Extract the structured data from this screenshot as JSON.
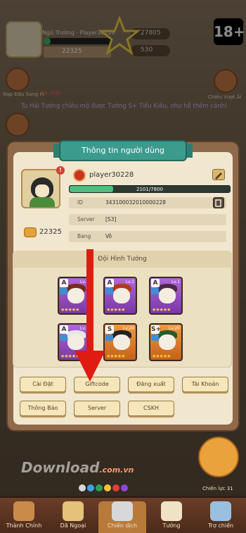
{
  "hud": {
    "name": "Ngũ Trường · Player30228",
    "power": "22325",
    "res1": "27805",
    "res2": "530",
    "age_badge": "18+",
    "exp_fraction": 0.1
  },
  "side": {
    "left_label": "Nạp Đầu Sang Hi",
    "right_label": "Chiêu Vượt Ải",
    "left_tag": "Đã nhận"
  },
  "ticker": "Tu Hải Tướng chiêu mộ được Tướng S+ Tiểu Kiều, như hổ thêm cánh!",
  "modal": {
    "title": "Thông tin người dùng",
    "player_name": "player30228",
    "exp_text": "2101/7800",
    "exp_fraction": 0.27,
    "rows": [
      {
        "label": "ID",
        "value": "343100032010000228"
      },
      {
        "label": "Server",
        "value": "[S3]"
      },
      {
        "label": "Bang",
        "value": "Vô"
      }
    ],
    "power": "22325",
    "team_title": "Đội Hình Tướng"
  },
  "heroes": [
    {
      "rank": "A",
      "level": "Lv.1",
      "color": "purple",
      "hair": "#7a2a1a",
      "stars": "★★★★★"
    },
    {
      "rank": "A",
      "level": "Lv.1",
      "color": "purple",
      "hair": "#b23b1a",
      "stars": "★★★★★"
    },
    {
      "rank": "A",
      "level": "Lv.1",
      "color": "purple",
      "hair": "#4a2a4a",
      "stars": "★★★★★"
    },
    {
      "rank": "A",
      "level": "Lv.1",
      "color": "purple",
      "hair": "#e6e6e6",
      "stars": "★★★★★"
    },
    {
      "rank": "S",
      "level": "Lv.20",
      "color": "orange",
      "hair": "#222222",
      "stars": "★★★★★"
    },
    {
      "rank": "S+",
      "level": "Lv.20",
      "color": "orange",
      "hair": "#2a5a2a",
      "stars": "★★★★★"
    }
  ],
  "buttons": {
    "settings": "Cài Đặt",
    "giftcode": "Giftcode",
    "logout": "Đăng xuất",
    "account": "Tài Khoản",
    "notice": "Thông Báo",
    "server": "Server",
    "cskh": "CSKH"
  },
  "watermark": {
    "brand": "Download",
    "tld": ".com.vn"
  },
  "bottom_right_label": "Chiến lực 31",
  "nav": [
    {
      "label": "Thành Chính"
    },
    {
      "label": "Dã Ngoại"
    },
    {
      "label": "Chiến dịch"
    },
    {
      "label": "Tướng"
    },
    {
      "label": "Trợ chiến"
    }
  ],
  "colors": {
    "accent": "#3b9c8d",
    "arrow": "#e01b12"
  }
}
